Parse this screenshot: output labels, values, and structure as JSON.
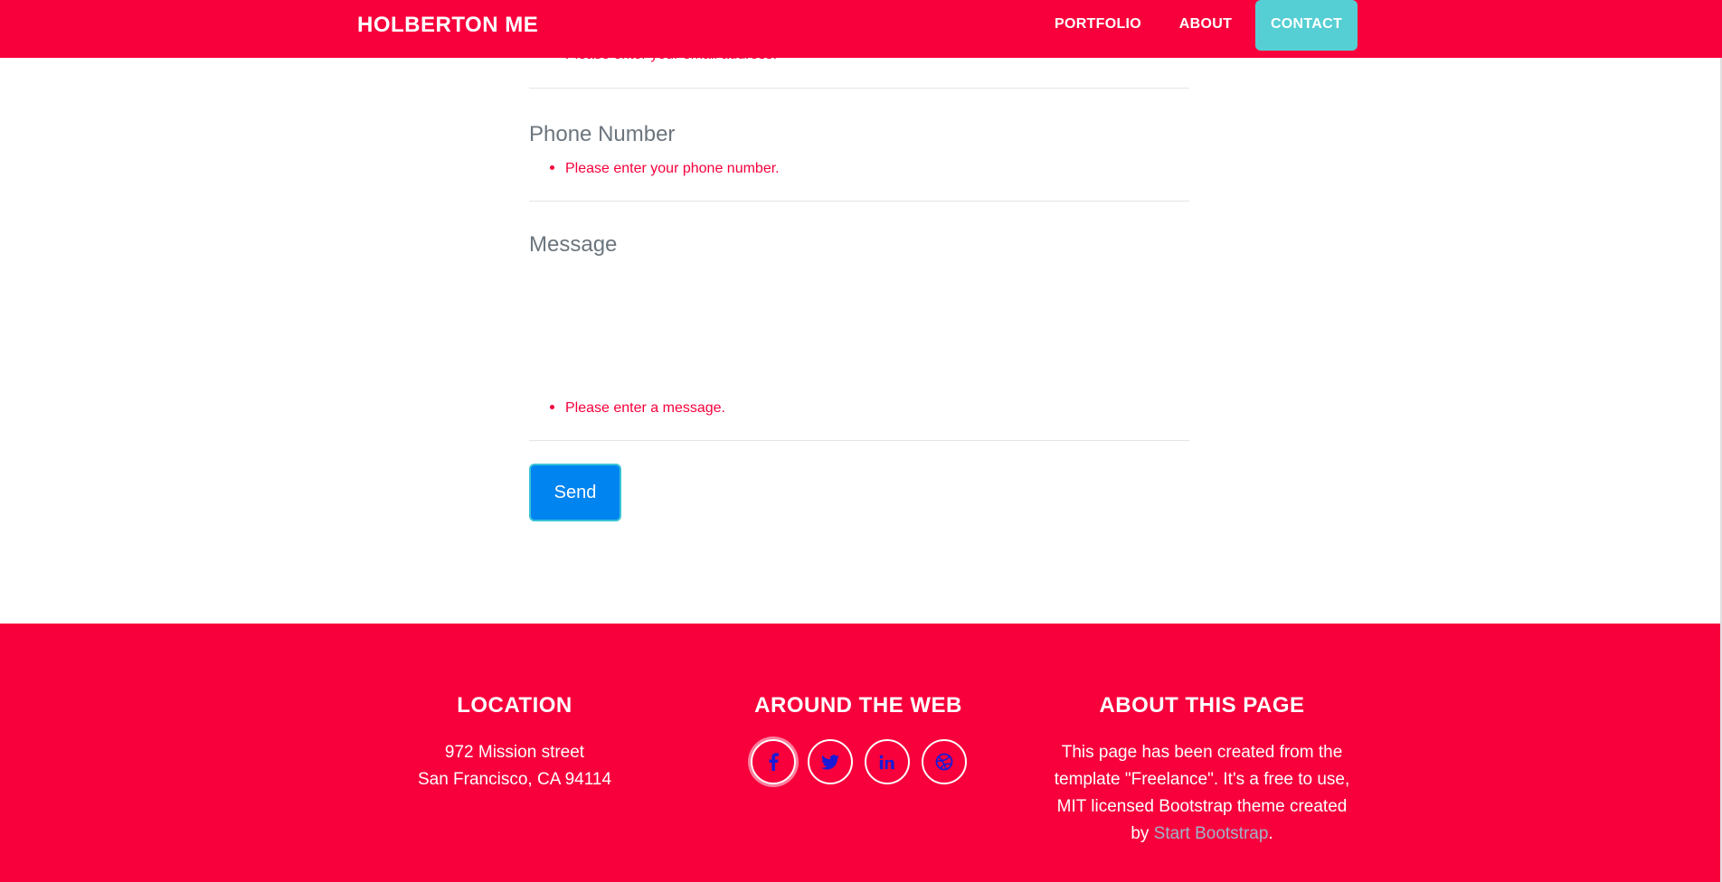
{
  "navbar": {
    "brand": "HOLBERTON ME",
    "links": [
      {
        "label": "PORTFOLIO"
      },
      {
        "label": "ABOUT"
      },
      {
        "label": "CONTACT"
      }
    ]
  },
  "form": {
    "email_error_partial": "Please enter your email address.",
    "phone": {
      "label": "Phone Number",
      "error": "Please enter your phone number."
    },
    "message": {
      "label": "Message",
      "error": "Please enter a message."
    },
    "send_label": "Send"
  },
  "footer": {
    "location": {
      "title": "LOCATION",
      "line1": "972 Mission street",
      "line2": "San Francisco, CA 94114"
    },
    "web": {
      "title": "AROUND THE WEB",
      "icons": [
        "facebook-icon",
        "twitter-icon",
        "linkedin-icon",
        "dribbble-icon"
      ]
    },
    "about": {
      "title": "ABOUT THIS PAGE",
      "text": "This page has been created from the template \"Freelance\". It's a free to use, MIT licensed Bootstrap theme created by",
      "link": "Start Bootstrap",
      "suffix": "."
    }
  },
  "colors": {
    "brand": "#f7003c",
    "accent": "#56cfd4",
    "button": "#0084f0"
  }
}
